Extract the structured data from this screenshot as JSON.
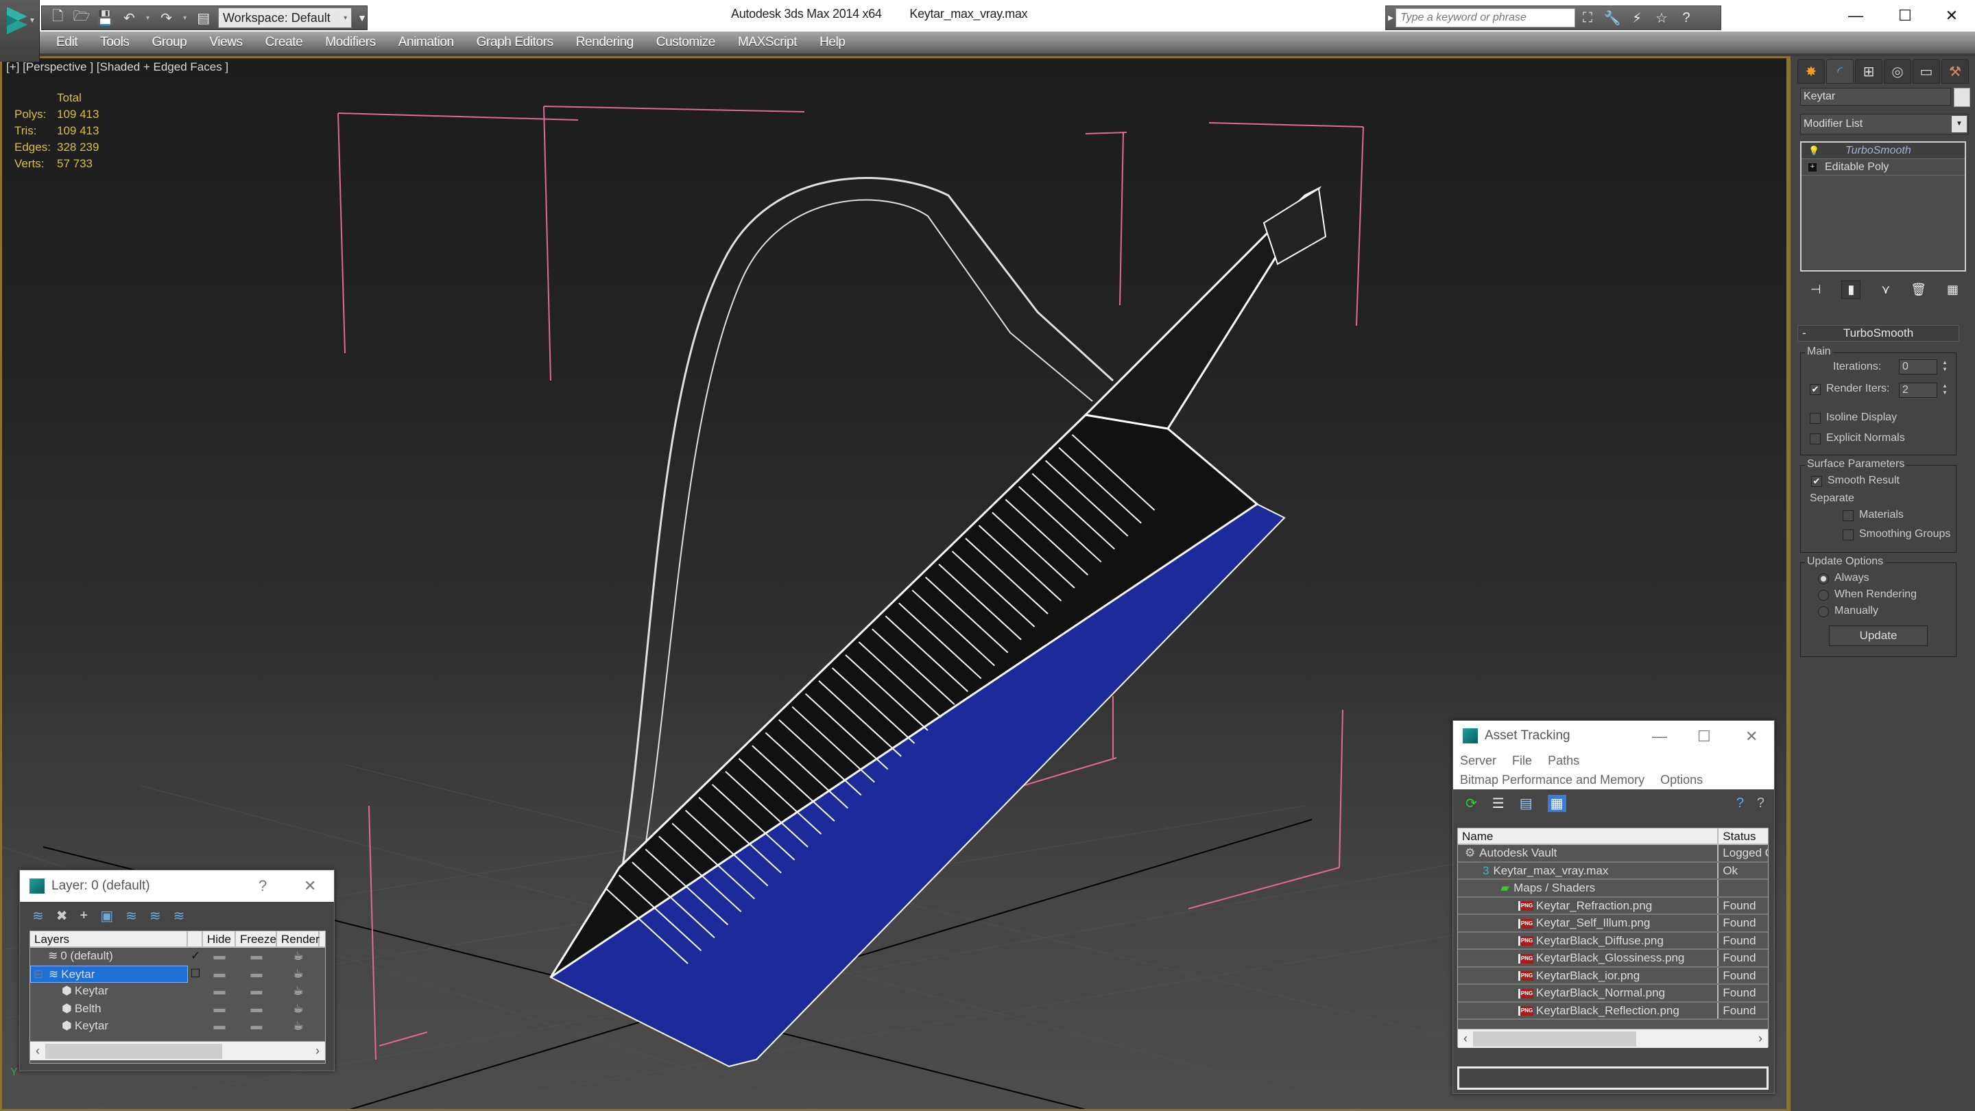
{
  "titlebar": {
    "app_name": "Autodesk 3ds Max 2014 x64",
    "file_name": "Keytar_max_vray.max",
    "workspace": "Workspace: Default",
    "search_placeholder": "Type a keyword or phrase",
    "minimize": "—",
    "maximize": "☐",
    "close": "✕"
  },
  "quick_access": [
    {
      "icon": "new-file-icon",
      "glyph": "🗋"
    },
    {
      "icon": "open-folder-icon",
      "glyph": "🗁"
    },
    {
      "icon": "save-icon",
      "glyph": "💾"
    },
    {
      "icon": "undo-icon",
      "glyph": "↶"
    },
    {
      "icon": "redo-icon",
      "glyph": "↷"
    },
    {
      "icon": "project-folder-icon",
      "glyph": "▤"
    }
  ],
  "search_tools": [
    {
      "icon": "binoculars-icon",
      "glyph": "⛶"
    },
    {
      "icon": "subscription-icon",
      "glyph": "🔧"
    },
    {
      "icon": "communication-center-icon",
      "glyph": "⚡"
    },
    {
      "icon": "favorites-icon",
      "glyph": "☆"
    },
    {
      "icon": "help-icon",
      "glyph": "?"
    }
  ],
  "menu": [
    "Edit",
    "Tools",
    "Group",
    "Views",
    "Create",
    "Modifiers",
    "Animation",
    "Graph Editors",
    "Rendering",
    "Customize",
    "MAXScript",
    "Help"
  ],
  "viewport": {
    "label": "[+] [Perspective ] [Shaded + Edged Faces ]",
    "stats": {
      "header": "Total",
      "rows": [
        {
          "label": "Polys:",
          "value": "109 413"
        },
        {
          "label": "Tris:",
          "value": "109 413"
        },
        {
          "label": "Edges:",
          "value": "328 239"
        },
        {
          "label": "Verts:",
          "value": "57 733"
        }
      ]
    },
    "axis_label": "Y"
  },
  "command_panel": {
    "tabs": [
      {
        "name": "create-tab",
        "glyph": "✸",
        "color": "#f0a020"
      },
      {
        "name": "modify-tab",
        "glyph": "◜",
        "color": "#4aa0e0"
      },
      {
        "name": "hierarchy-tab",
        "glyph": "⊞",
        "color": "#dddddd"
      },
      {
        "name": "motion-tab",
        "glyph": "◎",
        "color": "#cccccc"
      },
      {
        "name": "display-tab",
        "glyph": "▭",
        "color": "#dddddd"
      },
      {
        "name": "utilities-tab",
        "glyph": "⚒",
        "color": "#dd8866"
      }
    ],
    "object_name": "Keytar",
    "modifier_list": "Modifier List",
    "stack": [
      {
        "label": "TurboSmooth",
        "active": true
      },
      {
        "label": "Editable Poly",
        "active": false
      }
    ],
    "turbosmooth": {
      "title": "TurboSmooth",
      "main_group": "Main",
      "iterations_label": "Iterations:",
      "iterations_value": "0",
      "render_iters_label": "Render Iters:",
      "render_iters_value": "2",
      "render_iters_checked": true,
      "isoline_label": "Isoline Display",
      "isoline_checked": false,
      "explicit_normals_label": "Explicit Normals",
      "explicit_normals_checked": false,
      "surface_group": "Surface Parameters",
      "smooth_result_label": "Smooth Result",
      "smooth_result_checked": true,
      "separate_label": "Separate",
      "materials_label": "Materials",
      "smoothing_groups_label": "Smoothing Groups",
      "update_group": "Update Options",
      "update_options": [
        {
          "label": "Always",
          "selected": true
        },
        {
          "label": "When Rendering",
          "selected": false
        },
        {
          "label": "Manually",
          "selected": false
        }
      ],
      "update_button": "Update"
    }
  },
  "layer_dialog": {
    "title": "Layer: 0 (default)",
    "help": "?",
    "close": "✕",
    "columns": [
      "Layers",
      "",
      "Hide",
      "Freeze",
      "Render"
    ],
    "rows": [
      {
        "name": "0 (default)",
        "type": "layer",
        "current": "✓",
        "selected": false,
        "indent": 1
      },
      {
        "name": "Keytar",
        "type": "layer",
        "current": "☐",
        "selected": true,
        "indent": 1,
        "expander": "⊟"
      },
      {
        "name": "Keytar",
        "type": "object",
        "current": "",
        "selected": false,
        "indent": 2
      },
      {
        "name": "Belth",
        "type": "object",
        "current": "",
        "selected": false,
        "indent": 2
      },
      {
        "name": "Keytar",
        "type": "object",
        "current": "",
        "selected": false,
        "indent": 2
      }
    ]
  },
  "asset_tracking": {
    "title": "Asset Tracking",
    "menu_row1": [
      "Server",
      "File",
      "Paths"
    ],
    "menu_row2": [
      "Bitmap Performance and Memory",
      "Options"
    ],
    "columns": [
      "Name",
      "Status"
    ],
    "rows": [
      {
        "name": "Autodesk Vault",
        "status": "Logged Out",
        "indent": 1,
        "icon": "vault-icon"
      },
      {
        "name": "Keytar_max_vray.max",
        "status": "Ok",
        "indent": 2,
        "icon": "max-file-icon"
      },
      {
        "name": "Maps / Shaders",
        "status": "",
        "indent": 3,
        "icon": "maps-icon"
      },
      {
        "name": "Keytar_Refraction.png",
        "status": "Found",
        "indent": 4,
        "icon": "png-icon"
      },
      {
        "name": "Keytar_Self_Illum.png",
        "status": "Found",
        "indent": 4,
        "icon": "png-icon"
      },
      {
        "name": "KeytarBlack_Diffuse.png",
        "status": "Found",
        "indent": 4,
        "icon": "png-icon"
      },
      {
        "name": "KeytarBlack_Glossiness.png",
        "status": "Found",
        "indent": 4,
        "icon": "png-icon"
      },
      {
        "name": "KeytarBlack_ior.png",
        "status": "Found",
        "indent": 4,
        "icon": "png-icon"
      },
      {
        "name": "KeytarBlack_Normal.png",
        "status": "Found",
        "indent": 4,
        "icon": "png-icon"
      },
      {
        "name": "KeytarBlack_Reflection.png",
        "status": "Found",
        "indent": 4,
        "icon": "png-icon"
      }
    ]
  }
}
